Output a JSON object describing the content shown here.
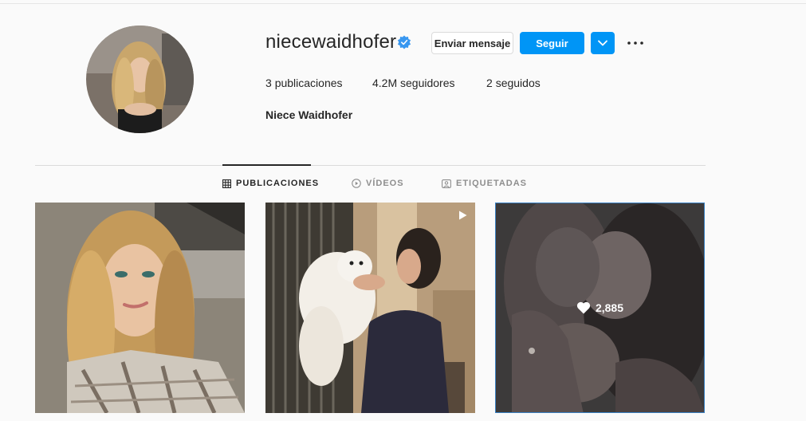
{
  "profile": {
    "username": "niecewaidhofer",
    "verified": true,
    "full_name": "Niece Waidhofer",
    "buttons": {
      "message": "Enviar mensaje",
      "follow": "Seguir",
      "dropdown_icon": "chevron-down-icon",
      "more_icon": "more-options-icon"
    },
    "stats": {
      "posts_count": "3",
      "posts_label": "publicaciones",
      "followers_count": "4.2M",
      "followers_label": "seguidores",
      "following_count": "2",
      "following_label": "seguidos"
    }
  },
  "tabs": [
    {
      "label": "PUBLICACIONES",
      "icon": "grid-icon",
      "active": true
    },
    {
      "label": "VÍDEOS",
      "icon": "video-tab-icon",
      "active": false
    },
    {
      "label": "ETIQUETADAS",
      "icon": "tagged-icon",
      "active": false
    }
  ],
  "posts": [
    {
      "type": "photo"
    },
    {
      "type": "video",
      "icon": "play-icon"
    },
    {
      "type": "photo",
      "hover": true,
      "likes": "2,885",
      "likes_icon": "heart-icon"
    }
  ],
  "colors": {
    "accent": "#0095f6",
    "verified": "#3897f0",
    "text": "#262626",
    "muted": "#8e8e8e",
    "background": "#fafafa"
  }
}
